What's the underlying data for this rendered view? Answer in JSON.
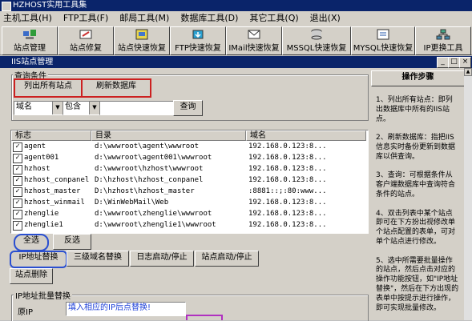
{
  "app_title": "HZHOST实用工具集",
  "menu": [
    "主机工具(H)",
    "FTP工具(F)",
    "邮局工具(M)",
    "数据库工具(D)",
    "其它工具(Q)",
    "退出(X)"
  ],
  "toolbar": [
    "站点管理",
    "站点修复",
    "站点快速恢复",
    "FTP快速恢复",
    "IMail快速恢复",
    "MSSQL快速恢复",
    "MYSQL快速恢复",
    "IP更换工具"
  ],
  "window": {
    "title": "IIS站点管理"
  },
  "query": {
    "group_label": "查询条件",
    "list_all": "列出所有站点",
    "refresh": "刷新数据库",
    "field_select": "域名",
    "op_select": "包含",
    "value": "",
    "query_btn": "查询"
  },
  "table": {
    "headers": [
      "标志",
      "目录",
      "域名"
    ],
    "rows": [
      {
        "name": "agent",
        "dir": "d:\\wwwroot\\agent\\wwwroot",
        "domain": "192.168.0.123:8..."
      },
      {
        "name": "agent001",
        "dir": "d:\\wwwroot\\agent001\\wwwroot",
        "domain": "192.168.0.123:8..."
      },
      {
        "name": "hzhost",
        "dir": "d:\\wwwroot\\hzhost\\wwwroot",
        "domain": "192.168.0.123:8..."
      },
      {
        "name": "hzhost_conpanel",
        "dir": "D:\\hzhost\\hzhost_conpanel",
        "domain": "192.168.0.123:8..."
      },
      {
        "name": "hzhost_master",
        "dir": "D:\\hzhost\\hzhost_master",
        "domain": ":8881::;:80:www..."
      },
      {
        "name": "hzhost_winmail",
        "dir": "D:\\WinWebMail\\Web",
        "domain": "192.168.0.123:8..."
      },
      {
        "name": "zhenglie",
        "dir": "d:\\wwwroot\\zhenglie\\wwwroot",
        "domain": "192.168.0.123:8..."
      },
      {
        "name": "zhenglie1",
        "dir": "d:\\wwwroot\\zhenglie1\\wwwroot",
        "domain": "192.168.0.123:8..."
      }
    ]
  },
  "actions": {
    "select_all": "全选",
    "invert": "反选",
    "ip_replace": "IP地址替换",
    "subdomain_replace": "三级域名替换",
    "log_toggle": "日志启动/停止",
    "site_toggle": "站点启动/停止",
    "site_delete": "站点删除"
  },
  "batch": {
    "group_label": "IP地址批量替换",
    "orig_ip_label": "原IP",
    "hint": "填入相应的IP后点替换!"
  },
  "help": {
    "title": "操作步骤",
    "text": "1、列出所有站点：即列出数据库中所有的IIS站点。\n\n2、刷新数据库：指把IIS信息实时备份更新到数据库以供查询。\n\n3、查询：可根据条件从客户端数据库中查询符合条件的站点。\n\n4、双击列表中某个站点即可在下方扮出视修改单个站点配置的表单，可对单个站点进行修改。\n\n5、选中所需要批量操作的站点，然后点击对应的操作功能按钮，如\"IP地址替换\"，然后在下方出现的表单中按提示进行操作，即可实现批量修改。"
  }
}
